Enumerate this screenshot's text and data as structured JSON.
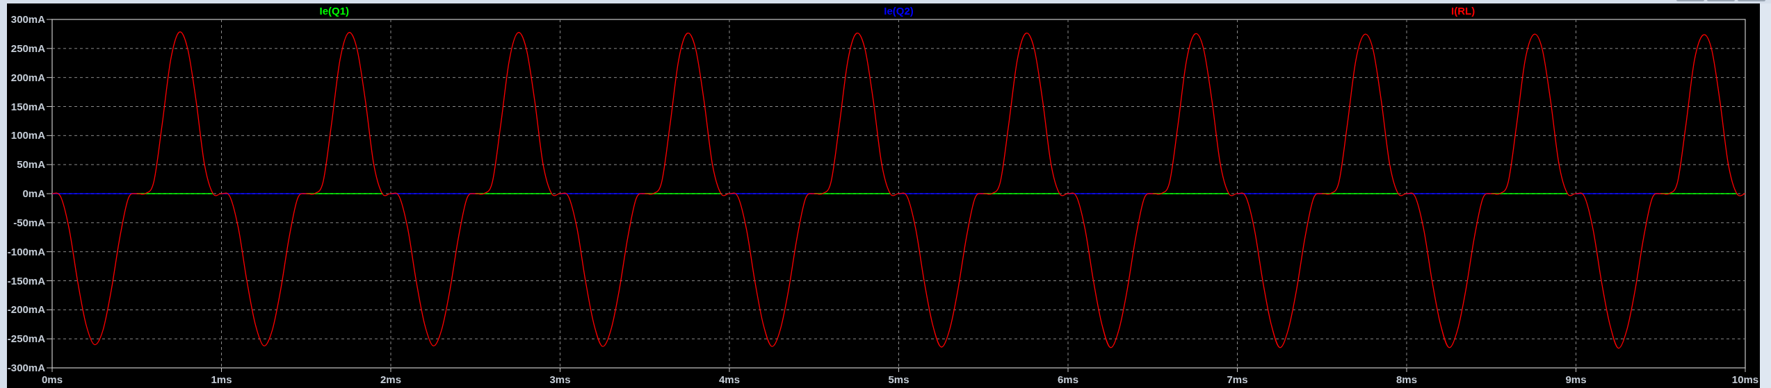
{
  "plot": {
    "chart_data": {
      "type": "line",
      "x": [
        0,
        0.05,
        0.1,
        0.15,
        0.2,
        0.25,
        0.3,
        0.35,
        0.4,
        0.45,
        0.5,
        0.55,
        0.6,
        0.65,
        0.7,
        0.75,
        0.8,
        0.85,
        0.9,
        0.95,
        1,
        1.05,
        1.1,
        1.15,
        1.2,
        1.25,
        1.3,
        1.35,
        1.4,
        1.45,
        1.5,
        1.55,
        1.6,
        1.65,
        1.7,
        1.75,
        1.8,
        1.85,
        1.9,
        1.95,
        2,
        2.05,
        2.1,
        2.15,
        2.2,
        2.25,
        2.3,
        2.35,
        2.4,
        2.45,
        2.5,
        2.55,
        2.6,
        2.65,
        2.7,
        2.75,
        2.8,
        2.85,
        2.9,
        2.95,
        3,
        3.05,
        3.1,
        3.15,
        3.2,
        3.25,
        3.3,
        3.35,
        3.4,
        3.45,
        3.5,
        3.55,
        3.6,
        3.65,
        3.7,
        3.75,
        3.8,
        3.85,
        3.9,
        3.95,
        4,
        4.05,
        4.1,
        4.15,
        4.2,
        4.25,
        4.3,
        4.35,
        4.4,
        4.45,
        4.5,
        4.55,
        4.6,
        4.65,
        4.7,
        4.75,
        4.8,
        4.85,
        4.9,
        4.95,
        5,
        5.05,
        5.1,
        5.15,
        5.2,
        5.25,
        5.3,
        5.35,
        5.4,
        5.45,
        5.5,
        5.55,
        5.6,
        5.65,
        5.7,
        5.75,
        5.8,
        5.85,
        5.9,
        5.95,
        6,
        6.05,
        6.1,
        6.15,
        6.2,
        6.25,
        6.3,
        6.35,
        6.4,
        6.45,
        6.5,
        6.55,
        6.6,
        6.65,
        6.7,
        6.75,
        6.8,
        6.85,
        6.9,
        6.95,
        7,
        7.05,
        7.1,
        7.15,
        7.2,
        7.25,
        7.3,
        7.35,
        7.4,
        7.45,
        7.5,
        7.55,
        7.6,
        7.65,
        7.7,
        7.75,
        7.8,
        7.85,
        7.9,
        7.95,
        8,
        8.05,
        8.1,
        8.15,
        8.2,
        8.25,
        8.3,
        8.35,
        8.4,
        8.45,
        8.5,
        8.55,
        8.6,
        8.65,
        8.7,
        8.75,
        8.8,
        8.85,
        8.9,
        8.95,
        9,
        9.05,
        9.1,
        9.15,
        9.2,
        9.25,
        9.3,
        9.35,
        9.4,
        9.45,
        9.5,
        9.55,
        9.6,
        9.65,
        9.7,
        9.75,
        9.8,
        9.85,
        9.9,
        9.95,
        10
      ],
      "series": [
        {
          "name": "Ie(Q1)",
          "color": "#00ff00",
          "values": [
            null,
            null,
            null,
            null,
            null,
            null,
            null,
            null,
            null,
            null,
            0,
            0,
            0,
            0,
            0,
            0,
            0,
            0,
            0,
            0,
            null,
            null,
            null,
            null,
            null,
            null,
            null,
            null,
            null,
            null,
            0,
            0,
            0,
            0,
            0,
            0,
            0,
            0,
            0,
            0,
            null,
            null,
            null,
            null,
            null,
            null,
            null,
            null,
            null,
            null,
            0,
            0,
            0,
            0,
            0,
            0,
            0,
            0,
            0,
            0,
            null,
            null,
            null,
            null,
            null,
            null,
            null,
            null,
            null,
            null,
            0,
            0,
            0,
            0,
            0,
            0,
            0,
            0,
            0,
            0,
            null,
            null,
            null,
            null,
            null,
            null,
            null,
            null,
            null,
            null,
            0,
            0,
            0,
            0,
            0,
            0,
            0,
            0,
            0,
            0,
            null,
            null,
            null,
            null,
            null,
            null,
            null,
            null,
            null,
            null,
            0,
            0,
            0,
            0,
            0,
            0,
            0,
            0,
            0,
            0,
            null,
            null,
            null,
            null,
            null,
            null,
            null,
            null,
            null,
            null,
            0,
            0,
            0,
            0,
            0,
            0,
            0,
            0,
            0,
            0,
            null,
            null,
            null,
            null,
            null,
            null,
            null,
            null,
            null,
            null,
            0,
            0,
            0,
            0,
            0,
            0,
            0,
            0,
            0,
            0,
            null,
            null,
            null,
            null,
            null,
            null,
            null,
            null,
            null,
            null,
            0,
            0,
            0,
            0,
            0,
            0,
            0,
            0,
            0,
            0,
            null,
            null,
            null,
            null,
            null,
            null,
            null,
            null,
            null,
            null,
            0,
            0,
            0,
            0,
            0,
            0,
            0,
            0,
            0,
            0,
            null
          ]
        },
        {
          "name": "Ie(Q2)",
          "color": "#0000ff",
          "values": [
            0,
            0,
            0,
            0,
            0,
            0,
            0,
            0,
            0,
            0,
            0,
            null,
            null,
            null,
            null,
            null,
            null,
            null,
            null,
            null,
            0,
            0,
            0,
            0,
            0,
            0,
            0,
            0,
            0,
            0,
            0,
            null,
            null,
            null,
            null,
            null,
            null,
            null,
            null,
            null,
            0,
            0,
            0,
            0,
            0,
            0,
            0,
            0,
            0,
            0,
            0,
            null,
            null,
            null,
            null,
            null,
            null,
            null,
            null,
            null,
            0,
            0,
            0,
            0,
            0,
            0,
            0,
            0,
            0,
            0,
            0,
            null,
            null,
            null,
            null,
            null,
            null,
            null,
            null,
            null,
            0,
            0,
            0,
            0,
            0,
            0,
            0,
            0,
            0,
            0,
            0,
            null,
            null,
            null,
            null,
            null,
            null,
            null,
            null,
            null,
            0,
            0,
            0,
            0,
            0,
            0,
            0,
            0,
            0,
            0,
            0,
            null,
            null,
            null,
            null,
            null,
            null,
            null,
            null,
            null,
            0,
            0,
            0,
            0,
            0,
            0,
            0,
            0,
            0,
            0,
            0,
            null,
            null,
            null,
            null,
            null,
            null,
            null,
            null,
            null,
            0,
            0,
            0,
            0,
            0,
            0,
            0,
            0,
            0,
            0,
            0,
            null,
            null,
            null,
            null,
            null,
            null,
            null,
            null,
            null,
            0,
            0,
            0,
            0,
            0,
            0,
            0,
            0,
            0,
            0,
            0,
            null,
            null,
            null,
            null,
            null,
            null,
            null,
            null,
            null,
            0,
            0,
            0,
            0,
            0,
            0,
            0,
            0,
            0,
            0,
            0,
            null,
            null,
            null,
            null,
            null,
            null,
            null,
            null,
            null,
            null
          ]
        },
        {
          "name": "I(RL)",
          "color": "#ff0000",
          "values": [
            0,
            -5,
            -60,
            -150,
            -225,
            -260,
            -235,
            -165,
            -75,
            -8,
            0,
            0,
            20,
            120,
            230,
            278,
            250,
            160,
            50,
            0,
            0,
            -5,
            -60,
            -150,
            -225,
            -262,
            -235,
            -165,
            -75,
            -8,
            0,
            0,
            20,
            120,
            230,
            277,
            250,
            160,
            50,
            0,
            0,
            -5,
            -60,
            -150,
            -225,
            -262,
            -235,
            -165,
            -75,
            -8,
            0,
            0,
            20,
            120,
            230,
            277,
            250,
            160,
            50,
            0,
            0,
            -5,
            -60,
            -150,
            -225,
            -263,
            -235,
            -165,
            -75,
            -8,
            0,
            0,
            20,
            120,
            230,
            276,
            250,
            160,
            50,
            0,
            0,
            -5,
            -60,
            -150,
            -225,
            -263,
            -235,
            -165,
            -75,
            -8,
            0,
            0,
            20,
            120,
            230,
            276,
            250,
            160,
            50,
            0,
            0,
            -5,
            -60,
            -150,
            -225,
            -264,
            -235,
            -165,
            -75,
            -8,
            0,
            0,
            20,
            120,
            230,
            276,
            250,
            160,
            50,
            0,
            0,
            -5,
            -60,
            -150,
            -225,
            -265,
            -235,
            -165,
            -75,
            -8,
            0,
            0,
            20,
            120,
            230,
            275,
            250,
            160,
            50,
            0,
            0,
            -5,
            -60,
            -150,
            -225,
            -265,
            -235,
            -165,
            -75,
            -8,
            0,
            0,
            20,
            120,
            230,
            274,
            250,
            160,
            50,
            0,
            0,
            -5,
            -60,
            -150,
            -225,
            -265,
            -235,
            -165,
            -75,
            -8,
            0,
            0,
            20,
            120,
            230,
            274,
            250,
            160,
            50,
            0,
            0,
            -5,
            -60,
            -150,
            -225,
            -266,
            -235,
            -165,
            -75,
            -8,
            0,
            0,
            20,
            120,
            230,
            273,
            250,
            160,
            50,
            0,
            0
          ]
        }
      ],
      "grid": true,
      "xlim": [
        0,
        10
      ],
      "ylim": [
        -300,
        300
      ],
      "xticks": [
        {
          "value": 0,
          "label": "0ms"
        },
        {
          "value": 1,
          "label": "1ms"
        },
        {
          "value": 2,
          "label": "2ms"
        },
        {
          "value": 3,
          "label": "3ms"
        },
        {
          "value": 4,
          "label": "4ms"
        },
        {
          "value": 5,
          "label": "5ms"
        },
        {
          "value": 6,
          "label": "6ms"
        },
        {
          "value": 7,
          "label": "7ms"
        },
        {
          "value": 8,
          "label": "8ms"
        },
        {
          "value": 9,
          "label": "9ms"
        },
        {
          "value": 10,
          "label": "10ms"
        }
      ],
      "yticks": [
        {
          "value": 300,
          "label": "300mA"
        },
        {
          "value": 250,
          "label": "250mA"
        },
        {
          "value": 200,
          "label": "200mA"
        },
        {
          "value": 150,
          "label": "150mA"
        },
        {
          "value": 100,
          "label": "100mA"
        },
        {
          "value": 50,
          "label": "50mA"
        },
        {
          "value": 0,
          "label": "0mA"
        },
        {
          "value": -50,
          "label": "-50mA"
        },
        {
          "value": -100,
          "label": "-100mA"
        },
        {
          "value": -150,
          "label": "-150mA"
        },
        {
          "value": -200,
          "label": "-200mA"
        },
        {
          "value": -250,
          "label": "-250mA"
        },
        {
          "value": -300,
          "label": "-300mA"
        }
      ]
    }
  }
}
